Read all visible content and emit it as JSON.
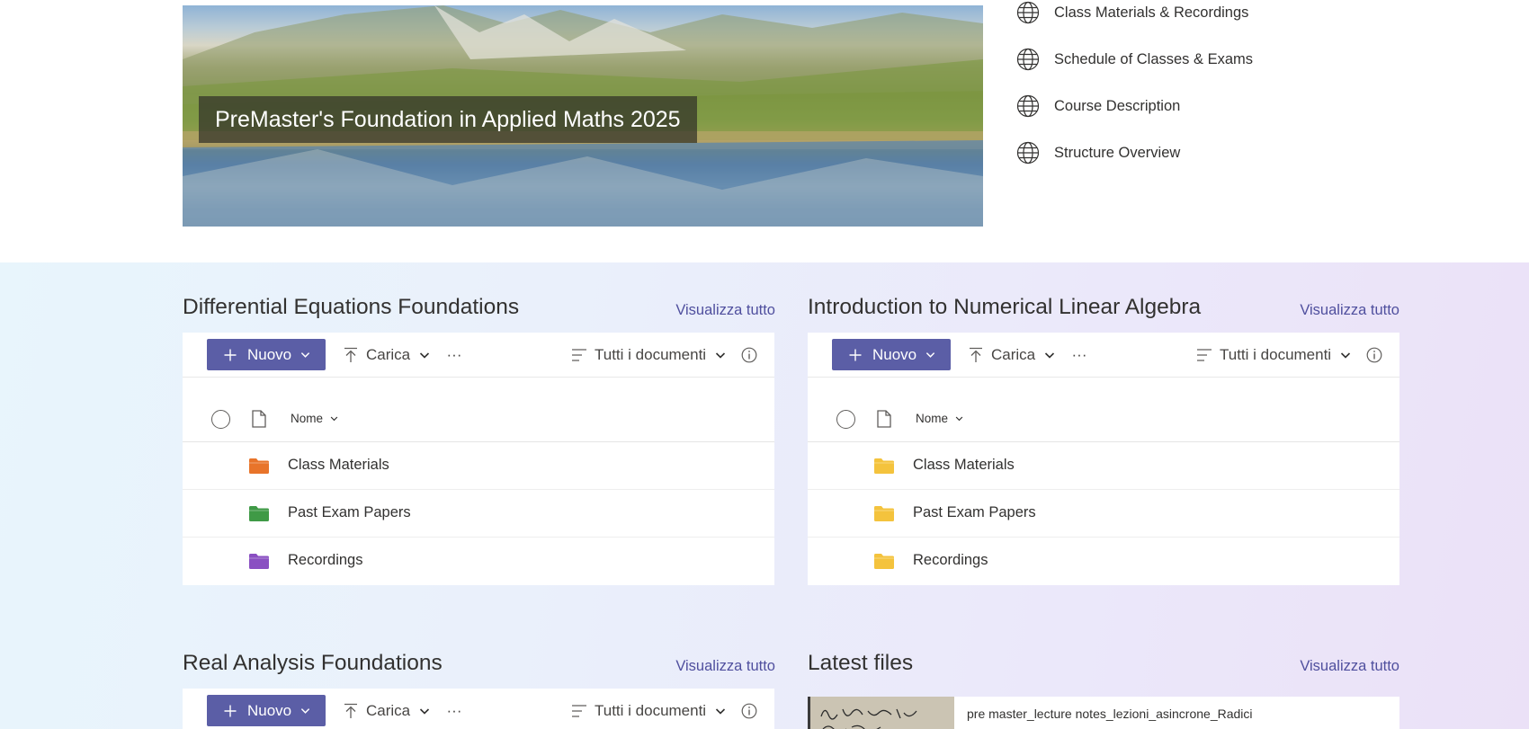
{
  "hero": {
    "title": "PreMaster's Foundation in Applied Maths 2025"
  },
  "quick_links": [
    {
      "label": "Class Materials & Recordings",
      "icon": "globe-icon"
    },
    {
      "label": "Schedule of Classes & Exams",
      "icon": "globe-icon"
    },
    {
      "label": "Course Description",
      "icon": "globe-icon"
    },
    {
      "label": "Structure Overview",
      "icon": "globe-icon"
    }
  ],
  "toolbar": {
    "new_label": "Nuovo",
    "upload_label": "Carica",
    "more_label": "···",
    "view_label": "Tutti i documenti"
  },
  "list_header": {
    "name_label": "Nome"
  },
  "libraries": [
    {
      "title": "Differential Equations Foundations",
      "view_all": "Visualizza tutto",
      "folders": [
        {
          "name": "Class Materials",
          "color": "#e8742a"
        },
        {
          "name": "Past Exam Papers",
          "color": "#3f9a46"
        },
        {
          "name": "Recordings",
          "color": "#8a4fc2"
        }
      ]
    },
    {
      "title": "Introduction to Numerical Linear Algebra",
      "view_all": "Visualizza tutto",
      "folders": [
        {
          "name": "Class Materials",
          "color": "#f4c33d"
        },
        {
          "name": "Past Exam Papers",
          "color": "#f4c33d"
        },
        {
          "name": "Recordings",
          "color": "#f4c33d"
        }
      ]
    },
    {
      "title": "Real Analysis Foundations",
      "view_all": "Visualizza tutto",
      "folders": []
    }
  ],
  "latest_files": {
    "title": "Latest files",
    "view_all": "Visualizza tutto",
    "items": [
      {
        "name": "pre master_lecture notes_lezioni_asincrone_Radici"
      }
    ]
  },
  "colors": {
    "accent": "#5b5ea6",
    "link": "#4f4f9e"
  }
}
